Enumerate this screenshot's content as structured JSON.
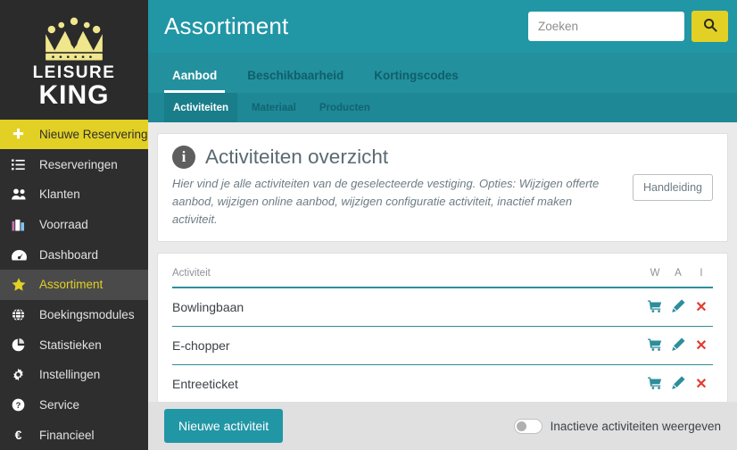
{
  "brand": {
    "line1": "LEISURE",
    "line2": "KING",
    "crown_icon": "crown-icon"
  },
  "colors": {
    "sidebar_bg": "#2e2e2e",
    "sidebar_active_bg": "#4a4a4a",
    "accent_yellow": "#e3d024",
    "teal_header": "#2196a5",
    "teal_nav": "#23909e",
    "teal_subnav": "#1f8896",
    "table_rule": "#2e8e9b",
    "danger_red": "#e23b32"
  },
  "sidebar": {
    "items": [
      {
        "label": "Nieuwe Reservering",
        "icon": "plus-icon",
        "state": "highlight"
      },
      {
        "label": "Reserveringen",
        "icon": "list-icon",
        "state": "normal"
      },
      {
        "label": "Klanten",
        "icon": "users-icon",
        "state": "normal"
      },
      {
        "label": "Voorraad",
        "icon": "briefcase-icon",
        "state": "normal"
      },
      {
        "label": "Dashboard",
        "icon": "dashboard-icon",
        "state": "normal"
      },
      {
        "label": "Assortiment",
        "icon": "star-icon",
        "state": "active"
      },
      {
        "label": "Boekingsmodules",
        "icon": "globe-icon",
        "state": "normal"
      },
      {
        "label": "Statistieken",
        "icon": "pie-chart-icon",
        "state": "normal"
      },
      {
        "label": "Instellingen",
        "icon": "gear-icon",
        "state": "normal"
      },
      {
        "label": "Service",
        "icon": "question-circle-icon",
        "state": "normal"
      },
      {
        "label": "Financieel",
        "icon": "euro-icon",
        "state": "normal"
      }
    ]
  },
  "header": {
    "title": "Assortiment",
    "search": {
      "placeholder": "Zoeken",
      "value": "",
      "button_icon": "search-icon"
    }
  },
  "nav_primary": {
    "tabs": [
      {
        "label": "Aanbod",
        "active": true
      },
      {
        "label": "Beschikbaarheid",
        "active": false
      },
      {
        "label": "Kortingscodes",
        "active": false
      }
    ]
  },
  "nav_secondary": {
    "tabs": [
      {
        "label": "Activiteiten",
        "active": true
      },
      {
        "label": "Materiaal",
        "active": false
      },
      {
        "label": "Producten",
        "active": false
      }
    ]
  },
  "info_panel": {
    "icon": "info-icon",
    "title": "Activiteiten overzicht",
    "description": "Hier vind je alle activiteiten van de geselecteerde vestiging. Opties: Wijzigen offerte aanbod, wijzigen online aanbod, wijzigen configuratie activiteit, inactief maken activiteit.",
    "manual_button": "Handleiding"
  },
  "table": {
    "columns": [
      "Activiteit",
      "W",
      "A",
      "I"
    ],
    "rows": [
      {
        "activiteit": "Bowlingbaan",
        "actions": [
          "cart-icon",
          "pencil-icon",
          "x-icon"
        ]
      },
      {
        "activiteit": "E-chopper",
        "actions": [
          "cart-icon",
          "pencil-icon",
          "x-icon"
        ]
      },
      {
        "activiteit": "Entreeticket",
        "actions": [
          "cart-icon",
          "pencil-icon",
          "x-icon"
        ]
      }
    ]
  },
  "footer": {
    "new_button": "Nieuwe activiteit",
    "toggle": {
      "label": "Inactieve activiteiten weergeven",
      "checked": false
    }
  }
}
